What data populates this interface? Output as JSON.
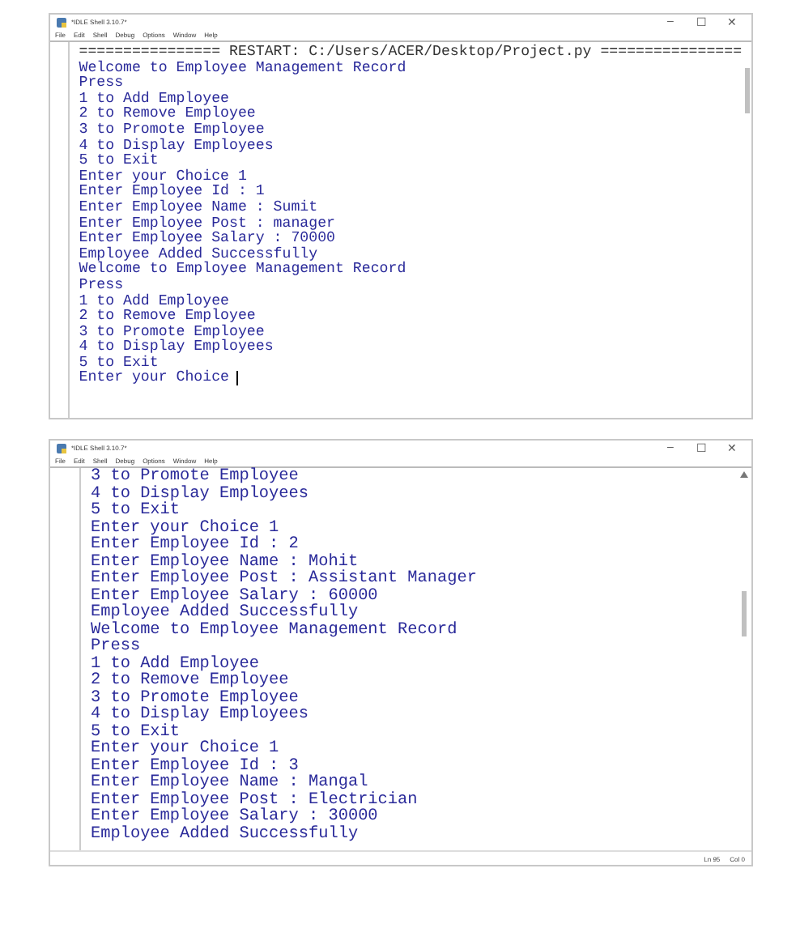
{
  "windows": [
    {
      "title": "*IDLE Shell 3.10.7*",
      "menu": [
        "File",
        "Edit",
        "Shell",
        "Debug",
        "Options",
        "Window",
        "Help"
      ],
      "controls": [
        "–",
        "☐",
        "✕"
      ],
      "cursor": true,
      "lines": [
        {
          "kind": "restart",
          "text": "================ RESTART: C:/Users/ACER/Desktop/Project.py ================"
        },
        {
          "kind": "output",
          "text": "Welcome to Employee Management Record"
        },
        {
          "kind": "output",
          "text": "Press"
        },
        {
          "kind": "output",
          "text": "1 to Add Employee"
        },
        {
          "kind": "output",
          "text": "2 to Remove Employee"
        },
        {
          "kind": "output",
          "text": "3 to Promote Employee"
        },
        {
          "kind": "output",
          "text": "4 to Display Employees"
        },
        {
          "kind": "output",
          "text": "5 to Exit"
        },
        {
          "kind": "output",
          "text": "Enter your Choice 1"
        },
        {
          "kind": "output",
          "text": "Enter Employee Id : 1"
        },
        {
          "kind": "output",
          "text": "Enter Employee Name : Sumit"
        },
        {
          "kind": "output",
          "text": "Enter Employee Post : manager"
        },
        {
          "kind": "output",
          "text": "Enter Employee Salary : 70000"
        },
        {
          "kind": "output",
          "text": "Employee Added Successfully"
        },
        {
          "kind": "output",
          "text": "Welcome to Employee Management Record"
        },
        {
          "kind": "output",
          "text": "Press"
        },
        {
          "kind": "output",
          "text": "1 to Add Employee"
        },
        {
          "kind": "output",
          "text": "2 to Remove Employee"
        },
        {
          "kind": "output",
          "text": "3 to Promote Employee"
        },
        {
          "kind": "output",
          "text": "4 to Display Employees"
        },
        {
          "kind": "output",
          "text": "5 to Exit"
        },
        {
          "kind": "output",
          "text": "Enter your Choice"
        }
      ]
    },
    {
      "title": "*IDLE Shell 3.10.7*",
      "menu": [
        "File",
        "Edit",
        "Shell",
        "Debug",
        "Options",
        "Window",
        "Help"
      ],
      "controls": [
        "–",
        "☐",
        "✕"
      ],
      "cursor": false,
      "status": [
        "Ln 95",
        "Col 0"
      ],
      "lines": [
        {
          "kind": "output",
          "text": "3 to Promote Employee"
        },
        {
          "kind": "output",
          "text": "4 to Display Employees"
        },
        {
          "kind": "output",
          "text": "5 to Exit"
        },
        {
          "kind": "output",
          "text": "Enter your Choice 1"
        },
        {
          "kind": "output",
          "text": "Enter Employee Id : 2"
        },
        {
          "kind": "output",
          "text": "Enter Employee Name : Mohit"
        },
        {
          "kind": "output",
          "text": "Enter Employee Post : Assistant Manager"
        },
        {
          "kind": "output",
          "text": "Enter Employee Salary : 60000"
        },
        {
          "kind": "output",
          "text": "Employee Added Successfully"
        },
        {
          "kind": "output",
          "text": "Welcome to Employee Management Record"
        },
        {
          "kind": "output",
          "text": "Press"
        },
        {
          "kind": "output",
          "text": "1 to Add Employee"
        },
        {
          "kind": "output",
          "text": "2 to Remove Employee"
        },
        {
          "kind": "output",
          "text": "3 to Promote Employee"
        },
        {
          "kind": "output",
          "text": "4 to Display Employees"
        },
        {
          "kind": "output",
          "text": "5 to Exit"
        },
        {
          "kind": "output",
          "text": "Enter your Choice 1"
        },
        {
          "kind": "output",
          "text": "Enter Employee Id : 3"
        },
        {
          "kind": "output",
          "text": "Enter Employee Name : Mangal"
        },
        {
          "kind": "output",
          "text": "Enter Employee Post : Electrician"
        },
        {
          "kind": "output",
          "text": "Enter Employee Salary : 30000"
        },
        {
          "kind": "output",
          "text": "Employee Added Successfully"
        }
      ]
    }
  ]
}
